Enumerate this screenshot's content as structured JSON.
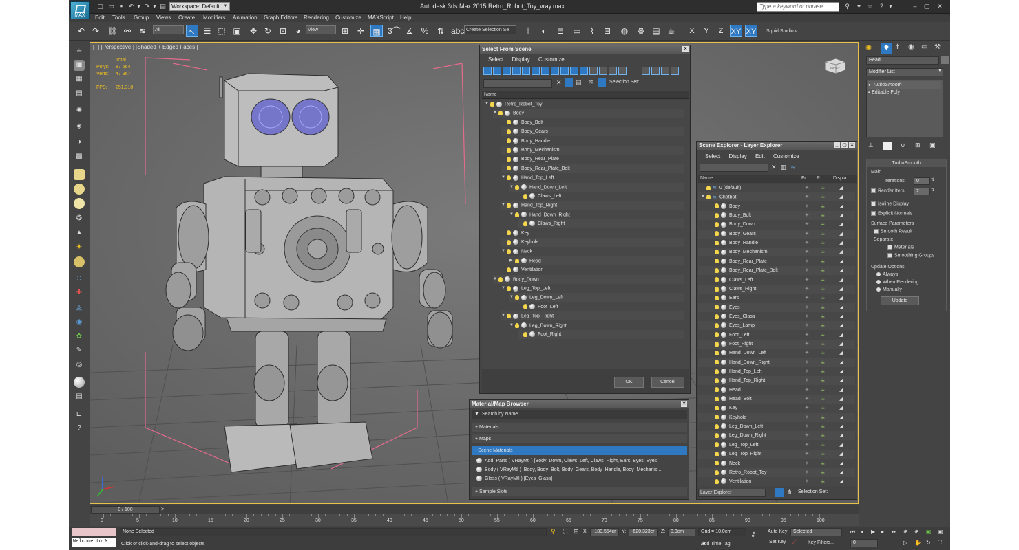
{
  "titlebar": {
    "workspace": "Workspace: Default",
    "title": "Autodesk 3ds Max  2015    Retro_Robot_Toy_vray.max",
    "search_placeholder": "Type a keyword or phrase",
    "logo_text": "MAX"
  },
  "menu": [
    "Edit",
    "Tools",
    "Group",
    "Views",
    "Create",
    "Modifiers",
    "Animation",
    "Graph Editors",
    "Rendering",
    "Customize",
    "MAXScript",
    "Help"
  ],
  "toolbar": {
    "selection_filter": "All",
    "view_dropdown": "View",
    "create_selection_set": "Create Selection Se",
    "axes": [
      "X",
      "Y",
      "Z",
      "XY",
      "XY"
    ],
    "squid": "Squid Studio v"
  },
  "viewport": {
    "label": "[+] [Perspective ] [Shaded + Edged Faces ]",
    "stats": {
      "total_label": "Total",
      "polys_label": "Polys:",
      "polys": "87 564",
      "verts_label": "Verts:",
      "verts": "47 967",
      "fps_label": "FPS:",
      "fps": "251,310"
    },
    "viewcube_label": "FRONT"
  },
  "select_from_scene": {
    "title": "Select From Scene",
    "menu": [
      "Select",
      "Display",
      "Customize"
    ],
    "selection_set_label": "Selection Set:",
    "column_name": "Name",
    "rows": [
      {
        "label": "Retro_Robot_Toy",
        "depth": 0,
        "expanded": true
      },
      {
        "label": "Body",
        "depth": 1,
        "expanded": true
      },
      {
        "label": "Body_Bolt",
        "depth": 2
      },
      {
        "label": "Body_Gears",
        "depth": 2
      },
      {
        "label": "Body_Handle",
        "depth": 2
      },
      {
        "label": "Body_Mechanism",
        "depth": 2
      },
      {
        "label": "Body_Rear_Plate",
        "depth": 2
      },
      {
        "label": "Body_Rear_Plate_Bolt",
        "depth": 2
      },
      {
        "label": "Hand_Top_Left",
        "depth": 2,
        "expanded": true
      },
      {
        "label": "Hand_Down_Left",
        "depth": 3,
        "expanded": true
      },
      {
        "label": "Claws_Left",
        "depth": 4
      },
      {
        "label": "Hand_Top_Right",
        "depth": 2,
        "expanded": true
      },
      {
        "label": "Hand_Down_Right",
        "depth": 3,
        "expanded": true
      },
      {
        "label": "Claws_Right",
        "depth": 4
      },
      {
        "label": "Key",
        "depth": 2
      },
      {
        "label": "Keyhole",
        "depth": 2
      },
      {
        "label": "Neck",
        "depth": 2,
        "expanded": true
      },
      {
        "label": "Head",
        "depth": 3,
        "collapsed": true
      },
      {
        "label": "Ventilation",
        "depth": 2
      },
      {
        "label": "Body_Down",
        "depth": 1,
        "expanded": true
      },
      {
        "label": "Leg_Top_Left",
        "depth": 2,
        "expanded": true
      },
      {
        "label": "Leg_Down_Left",
        "depth": 3,
        "expanded": true
      },
      {
        "label": "Foot_Left",
        "depth": 4
      },
      {
        "label": "Leg_Top_Right",
        "depth": 2,
        "expanded": true
      },
      {
        "label": "Leg_Down_Right",
        "depth": 3,
        "expanded": true
      },
      {
        "label": "Foot_Right",
        "depth": 4
      }
    ],
    "ok": "OK",
    "cancel": "Cancel"
  },
  "scene_explorer": {
    "title": "Scene Explorer - Layer Explorer",
    "menu": [
      "Select",
      "Display",
      "Edit",
      "Customize"
    ],
    "columns": [
      "Name",
      "Fr...",
      "R...",
      "Displa..."
    ],
    "layers": [
      {
        "label": "0 (default)",
        "depth": 0
      },
      {
        "label": "Chatbot",
        "depth": 0
      }
    ],
    "objects": [
      "Body",
      "Body_Bolt",
      "Body_Down",
      "Body_Gears",
      "Body_Handle",
      "Body_Mechanism",
      "Body_Rear_Plate",
      "Body_Rear_Plate_Bolt",
      "Claws_Left",
      "Claws_Right",
      "Ears",
      "Eyes",
      "Eyes_Glass",
      "Eyes_Lamp",
      "Foot_Left",
      "Foot_Right",
      "Hand_Down_Left",
      "Hand_Down_Right",
      "Hand_Top_Left",
      "Hand_Top_Right",
      "Head",
      "Head_Bolt",
      "Key",
      "Keyhole",
      "Leg_Down_Left",
      "Leg_Down_Right",
      "Leg_Top_Left",
      "Leg_Top_Right",
      "Neck",
      "Retro_Robot_Toy",
      "Ventilation"
    ],
    "footer_dropdown": "Layer Explorer",
    "footer_selection_set": "Selection Set:"
  },
  "material_browser": {
    "title": "Material/Map Browser",
    "search_placeholder": "Search by Name ...",
    "sections": [
      "+ Materials",
      "+ Maps",
      "- Scene Materials",
      "+ Sample Slots"
    ],
    "materials": [
      "Add_Parts  ( VRayMtl ) [Body_Down, Claws_Left, Claws_Right, Ears, Eyes, Eyes_",
      "Body  ( VRayMtl ) [Body, Body_Bolt, Body_Gears, Body_Handle, Body_Mechanis...",
      "Glass  ( VRayMtl ) [Eyes_Glass]"
    ]
  },
  "command_panel": {
    "object_name": "Head",
    "modifier_list": "Modifier List",
    "stack": [
      "TurboSmooth",
      "Editable Poly"
    ],
    "rollout_title": "TurboSmooth",
    "main_label": "Main",
    "iterations_label": "Iterations:",
    "iterations": "0",
    "render_iters_label": "Render Iters:",
    "render_iters": "2",
    "isoline_label": "Isoline Display",
    "explicit_normals_label": "Explicit Normals",
    "surface_params_label": "Surface Parameters",
    "smooth_result_label": "Smooth Result",
    "separate_label": "Separate",
    "materials_label": "Materials",
    "smoothing_groups_label": "Smoothing Groups",
    "update_options_label": "Update Options",
    "always_label": "Always",
    "when_rendering_label": "When Rendering",
    "manually_label": "Manually",
    "update_button": "Update"
  },
  "timeline": {
    "frame": "0 / 100",
    "ticks": [
      "0",
      "5",
      "10",
      "15",
      "20",
      "25",
      "30",
      "35",
      "40",
      "45",
      "50",
      "55",
      "60",
      "65",
      "70",
      "75",
      "80",
      "85",
      "90",
      "95",
      "100"
    ]
  },
  "status": {
    "maxscript": "Welcome to M:",
    "selection": "None Selected",
    "prompt": "Click or click-and-drag to select objects",
    "x_label": "X:",
    "x": "-180,554cr",
    "y_label": "Y:",
    "y": "-620,323cr",
    "z_label": "Z:",
    "z": "0,0cm",
    "grid": "Grid = 10,0cm",
    "add_time_tag": "Add Time Tag",
    "auto_key": "Auto Key",
    "set_key": "Set Key",
    "selected_dropdown": "Selected",
    "key_filters": "Key Filters...",
    "frame_field": "0"
  },
  "colors": {
    "accent": "#2f79c3",
    "stats": "#f0c020",
    "background": "#444444",
    "viewport": "#6b6b6b"
  }
}
